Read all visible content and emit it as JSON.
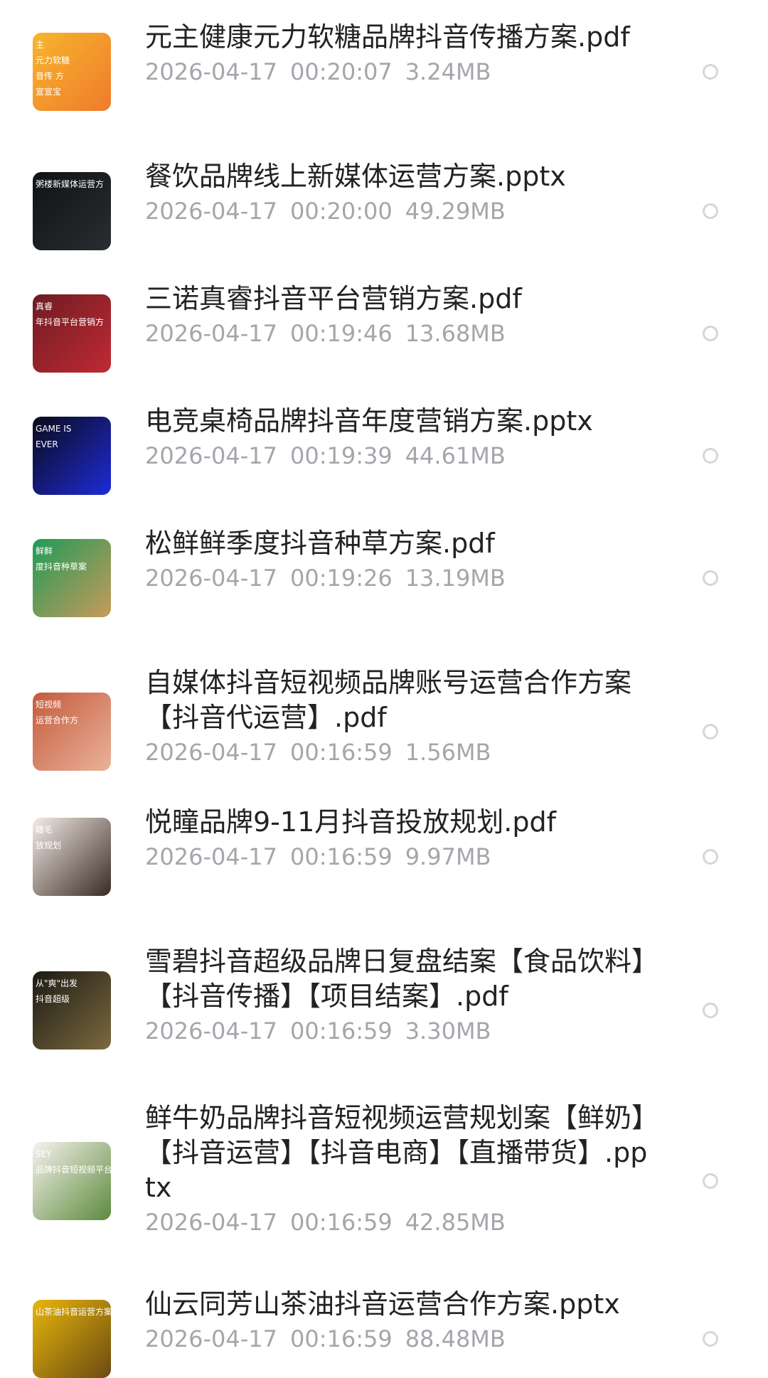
{
  "files": [
    {
      "name": "元主健康元力软糖品牌抖音传播方案.pdf",
      "date": "2026-04-17",
      "time": "00:20:07",
      "size": "3.24MB",
      "thumbnail_text": [
        "主",
        "元力软糖",
        "音传 方",
        "宣宣宝"
      ],
      "thumbnail_colors": [
        "#f6b52c",
        "#f07b2d"
      ]
    },
    {
      "name": "餐饮品牌线上新媒体运营方案.pptx",
      "date": "2026-04-17",
      "time": "00:20:00",
      "size": "49.29MB",
      "thumbnail_text": [
        "粥楼新媒体运营方"
      ],
      "thumbnail_colors": [
        "#101214",
        "#2a2d31"
      ]
    },
    {
      "name": "三诺真睿抖音平台营销方案.pdf",
      "date": "2026-04-17",
      "time": "00:19:46",
      "size": "13.68MB",
      "thumbnail_text": [
        "真睿",
        "年抖音平台营销方"
      ],
      "thumbnail_colors": [
        "#6e1b22",
        "#c02a33"
      ]
    },
    {
      "name": "电竞桌椅品牌抖音年度营销方案.pptx",
      "date": "2026-04-17",
      "time": "00:19:39",
      "size": "44.61MB",
      "thumbnail_text": [
        "GAME IS",
        "EVER"
      ],
      "thumbnail_colors": [
        "#0a0b18",
        "#1e2bd9"
      ]
    },
    {
      "name": "松鲜鲜季度抖音种草方案.pdf",
      "date": "2026-04-17",
      "time": "00:19:26",
      "size": "13.19MB",
      "thumbnail_text": [
        "鲜鲜",
        "度抖音种草案"
      ],
      "thumbnail_colors": [
        "#1f9b58",
        "#c89a5a"
      ]
    },
    {
      "name": "自媒体抖音短视频品牌账号运营合作方案【抖音代运营】.pdf",
      "date": "2026-04-17",
      "time": "00:16:59",
      "size": "1.56MB",
      "thumbnail_text": [
        "短视频",
        "运营合作方"
      ],
      "thumbnail_colors": [
        "#c55a3c",
        "#e9b39a"
      ]
    },
    {
      "name": "悦瞳品牌9-11月抖音投放规划.pdf",
      "date": "2026-04-17",
      "time": "00:16:59",
      "size": "9.97MB",
      "thumbnail_text": [
        "睫毛",
        "放规划"
      ],
      "thumbnail_colors": [
        "#f4ece6",
        "#3a2a24"
      ]
    },
    {
      "name": "雪碧抖音超级品牌日复盘结案【食品饮料】【抖音传播】【项目结案】.pdf",
      "date": "2026-04-17",
      "time": "00:16:59",
      "size": "3.30MB",
      "thumbnail_text": [
        "从\"爽\"出发",
        "抖音超级"
      ],
      "thumbnail_colors": [
        "#1c1a14",
        "#7b6a3e"
      ]
    },
    {
      "name": "鲜牛奶品牌抖音短视频运营规划案【鲜奶】【抖音运营】【抖音电商】【直播带货】.pptx",
      "date": "2026-04-17",
      "time": "00:16:59",
      "size": "42.85MB",
      "thumbnail_text": [
        "SEY",
        "品牌抖音短视频平台运"
      ],
      "thumbnail_colors": [
        "#f6f3ee",
        "#5d8a3c"
      ]
    },
    {
      "name": "仙云同芳山茶油抖音运营合作方案.pptx",
      "date": "2026-04-17",
      "time": "00:16:59",
      "size": "88.48MB",
      "thumbnail_text": [
        "山茶油抖音运营方案"
      ],
      "thumbnail_colors": [
        "#e7b60a",
        "#6b4a12"
      ]
    }
  ]
}
